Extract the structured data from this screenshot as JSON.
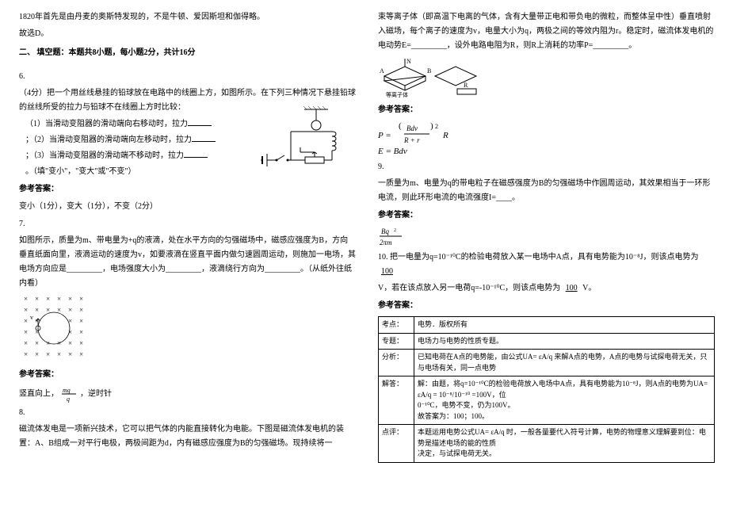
{
  "left": {
    "pre1": "1820年首先是由丹麦的奥斯特发现的，不是牛顿、爱因斯坦和伽得略。",
    "pre2": "故选D。",
    "section2": "二、 填空题：本题共8小题，每小题2分，共计16分",
    "q6": {
      "num": "6.",
      "stem": "（4分）把一个用丝线悬挂的铅球放在电路中的线圈上方，如图所示。在下列三种情况下悬挂铅球的丝线所受的拉力与铅球不在线圈上方时比较：",
      "sub1": "（1）当滑动变阻器的滑动端向右移动时，拉力",
      "sub2": "（2）当滑动变阻器的滑动端向左移动时，拉力",
      "sub3": "（3）当滑动变阻器的滑动端不移动时，拉力",
      "hint": "。（填\"变小\"，\"变大\"或\"不变\"）",
      "ans_label": "参考答案：",
      "ans": "变小（1分），变大（1分），不变（2分）"
    },
    "q7": {
      "num": "7.",
      "stem": "如图所示，质量为m、带电量为+q的液滴，处在水平方向的匀强磁场中，磁感应强度为B，方向垂直纸面向里，液滴运动的速度为v，如要液滴在竖直平面内做匀速圆周运动，则施加一电场，其电场方向应是_________，电场强度大小为_________，液滴绕行方向为_________。（从纸外往纸内看）",
      "ans_label": "参考答案：",
      "ans_pre": "竖直向上，",
      "ans_formula": "mg/q",
      "ans_post": "，逆时针"
    },
    "q8": {
      "num": "8.",
      "stem": "磁流体发电是一项新兴技术，它可以把气体的内能直接转化为电能。下图是磁流体发电机的装置：A、B组成一对平行电极，两极间距为d，内有磁感应强度为B的匀强磁场。现持续将一"
    }
  },
  "right": {
    "cont": "束等离子体（即高温下电离的气体，含有大量带正电和带负电的微粒，而整体呈中性）垂直喷射入磁场，每个离子的速度为v，电量大小为q，两极之间的等效内阻为r。稳定时，磁流体发电机的电动势E=_________，设外电路电阻为R，则R上消耗的功率P=_________。",
    "ans_label": "参考答案：",
    "formula1": "E = Bdv",
    "formula2": "P = (Bdv/(R+r))² R",
    "q9": {
      "num": "9.",
      "stem": "一质量为m、电量为q的带电粒子在磁感强度为B的匀强磁场中作圆周运动，其效果相当于一环形电流，则此环形电流的电流强度I=____。",
      "ans_label": "参考答案：",
      "ans_formula": "Bq²/(2πm)"
    },
    "q10": {
      "num": "10.",
      "stem_pre": "把一电量为q=10⁻¹⁰C的检验电荷放入某一电场中A点，具有电势能为10⁻⁸J，则该点电势为",
      "blank1": "100",
      "stem_mid": "V，若在该点放入另一电荷q=-10⁻¹⁰C，则该点电势为",
      "blank2": "100",
      "stem_post": "V。",
      "ans_label": "参考答案："
    },
    "table": {
      "r1_l": "考点：",
      "r1_v": "电势．版权所有",
      "r2_l": "专题：",
      "r2_v": "电场力与电势的性质专题。",
      "r3_l": "分析：",
      "r3_v": "已知电荷在A点的电势能，由公式UA= εA/q 来解A点的电势，A点的电势与试探电荷无关，只与电场有关，同一点电势",
      "r4_l": "解答：",
      "r4_v": "解：由题，将q=10⁻¹⁰C的检验电荷放入电场中A点，具有电势能为10⁻⁸J，则A点的电势为UA= εA/q = 10⁻⁸/10⁻¹⁰ =100V，位\n0⁻¹⁰C，电势不变，仍为100V。\n故答案为：100；100。",
      "r5_l": "点评：",
      "r5_v": "本题运用电势公式UA= εA/q 时，一般各量要代入符号计算，电势的物理意义理解要到位：电势是描述电场的能的性质\n决定，与试探电荷无关。"
    }
  },
  "chart_data": null
}
